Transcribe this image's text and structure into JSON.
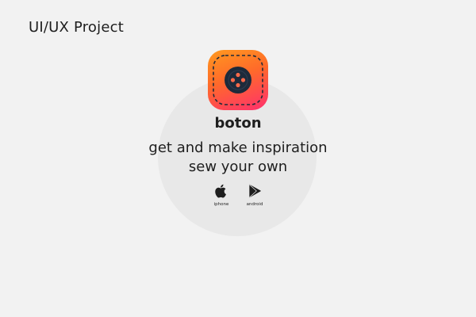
{
  "header": {
    "title": "UI/UX Project"
  },
  "app": {
    "name": "boton",
    "icon": "sewing-button-icon",
    "tagline_line1": "get and make inspiration",
    "tagline_line2": "sew your own"
  },
  "stores": [
    {
      "label": "iphone",
      "icon": "apple-icon"
    },
    {
      "label": "android",
      "icon": "google-play-icon"
    }
  ],
  "colors": {
    "background": "#f2f2f2",
    "circle": "#e8e8e8",
    "icon_gradient_start": "#ff9a1f",
    "icon_gradient_end": "#ff2f6e",
    "button_dark": "#1e2a3a",
    "button_holes": "#ff6a4a",
    "text": "#1e1e1e"
  }
}
